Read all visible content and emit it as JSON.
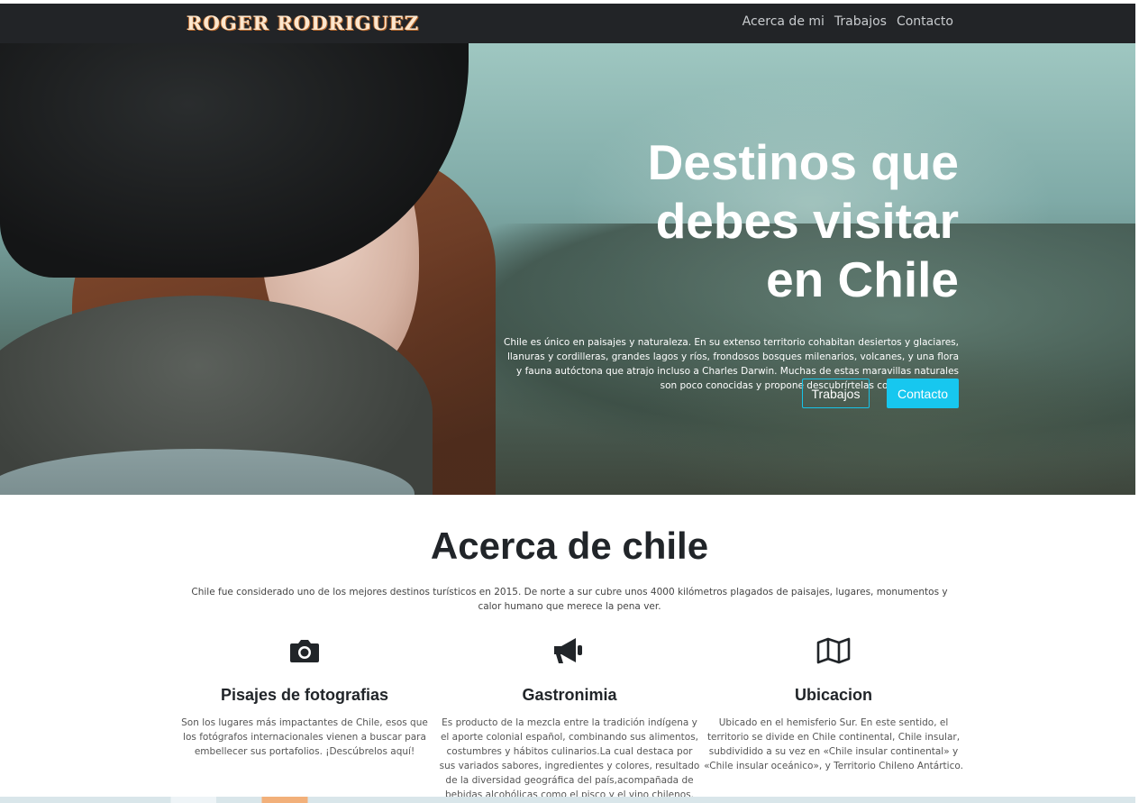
{
  "nav": {
    "brand": "ROGER RODRIGUEZ",
    "links": [
      "Acerca de mi",
      "Trabajos",
      "Contacto"
    ]
  },
  "hero": {
    "title_lines": [
      "Destinos que",
      "debes visitar",
      "en Chile"
    ],
    "paragraph": "Chile es único en paisajes y naturaleza. En su extenso territorio cohabitan desiertos y glaciares, llanuras y cordilleras, grandes lagos y ríos, frondosos bosques milenarios, volcanes, y una flora y fauna autóctona que atrajo incluso a Charles Darwin. Muchas de estas maravillas naturales son poco conocidas y propone descubrírtelas con este artículo.",
    "buttons": {
      "primary_outline": "Trabajos",
      "primary_solid": "Contacto"
    },
    "accent_color": "#17c7ef"
  },
  "about": {
    "title": "Acerca de chile",
    "text": "Chile fue considerado uno de los mejores destinos turísticos en 2015. De norte a sur cubre unos 4000 kilómetros plagados de paisajes, lugares, monumentos y calor humano que merece la pena ver.",
    "features": [
      {
        "icon": "camera-icon",
        "title": "Pisajes de fotografias",
        "text": "Son los lugares más impactantes de Chile, esos que los fotógrafos internacionales vienen a buscar para embellecer sus portafolios. ¡Descúbrelos aquí!"
      },
      {
        "icon": "megaphone-icon",
        "title": "Gastronimia",
        "text": "Es producto de la mezcla entre la tradición indígena y el aporte colonial español, combinando sus alimentos, costumbres y hábitos culinarios.La cual destaca por sus variados sabores, ingredientes y colores, resultado de la diversidad geográfica del país,acompañada de bebidas alcohólicas como el pisco y el vino chilenos."
      },
      {
        "icon": "map-icon",
        "title": "Ubicacion",
        "text": "Ubicado en el hemisferio Sur. En este sentido, el territorio se divide en Chile continental, Chile insular, subdividido a su vez en «Chile insular continental» y «Chile insular oceánico», y Territorio Chileno Antártico."
      }
    ]
  }
}
